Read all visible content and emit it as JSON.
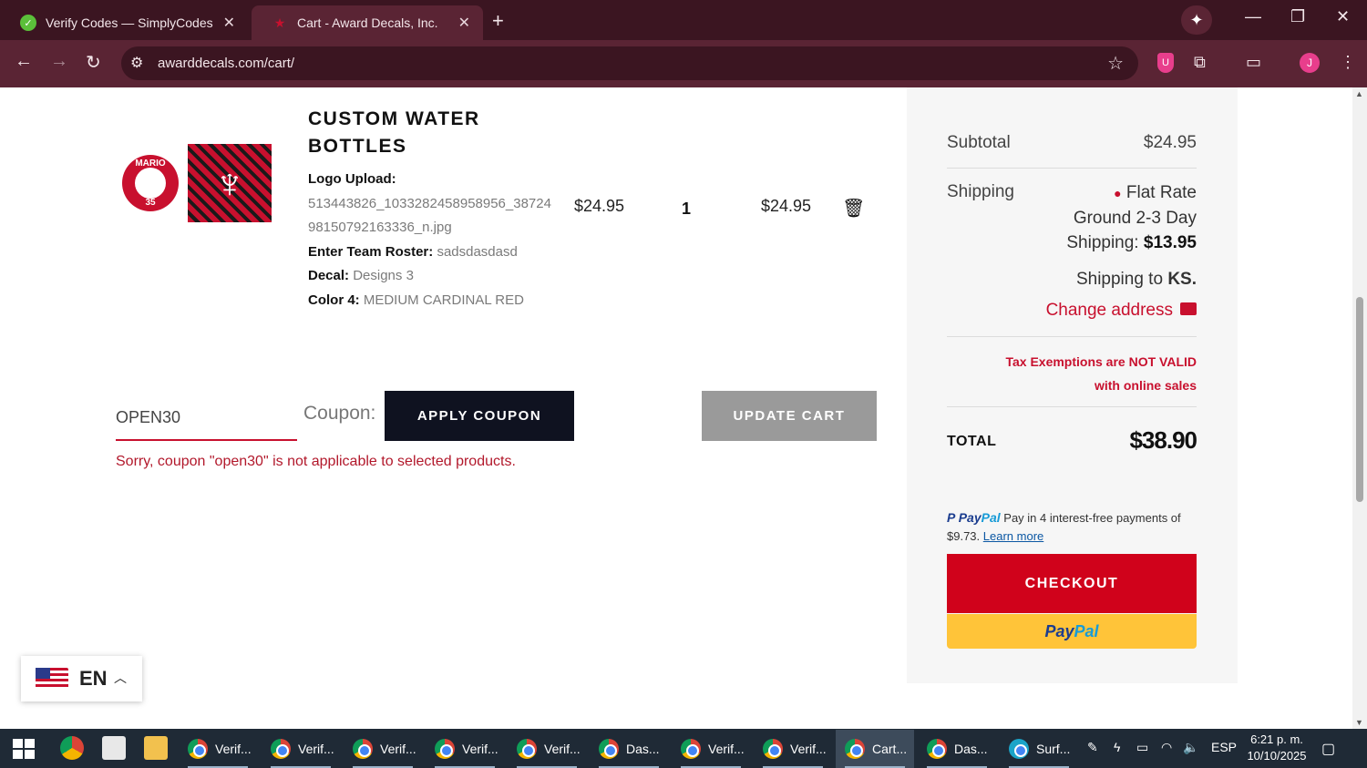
{
  "browser": {
    "tabs": [
      {
        "title": "Verify Codes — SimplyCodes",
        "active": false
      },
      {
        "title": "Cart - Award Decals, Inc.",
        "active": true
      }
    ],
    "url": "awarddecals.com/cart/"
  },
  "product": {
    "thumb_text_top": "MARIO",
    "thumb_text_bottom": "35",
    "name": "CUSTOM WATER BOTTLES",
    "logo_upload_label": "Logo Upload:",
    "logo_upload_value": "513443826_1033282458958956_3872498150792163336_n.jpg",
    "roster_label": "Enter Team Roster:",
    "roster_value": "sadsdasdasd",
    "decal_label": "Decal:",
    "decal_value": "Designs 3",
    "color_label": "Color 4:",
    "color_value": "MEDIUM CARDINAL RED",
    "price": "$24.95",
    "quantity": "1",
    "subtotal": "$24.95"
  },
  "coupon": {
    "input_value": "OPEN30",
    "label": "Coupon:",
    "apply_label": "APPLY COUPON",
    "update_label": "UPDATE CART",
    "error": "Sorry, coupon \"open30\" is not applicable to selected products."
  },
  "language": {
    "code": "EN"
  },
  "totals": {
    "subtotal_label": "Subtotal",
    "subtotal_value": "$24.95",
    "shipping_label": "Shipping",
    "shipping_method": "Flat Rate Ground 2-3 Day Shipping:",
    "shipping_cost": "$13.95",
    "shipping_to_prefix": "Shipping to",
    "shipping_to_state": "KS.",
    "change_address": "Change address",
    "tax_note_1": "Tax Exemptions are NOT VALID",
    "tax_note_2": "with online sales",
    "total_label": "TOTAL",
    "total_value": "$38.90",
    "paypal_message": "Pay in 4 interest-free payments of $9.73.",
    "paypal_learn_more": "Learn more",
    "checkout_label": "CHECKOUT"
  },
  "taskbar": {
    "tasks": [
      {
        "label": "Verif...",
        "active": false
      },
      {
        "label": "Verif...",
        "active": false
      },
      {
        "label": "Verif...",
        "active": false
      },
      {
        "label": "Verif...",
        "active": false
      },
      {
        "label": "Verif...",
        "active": false
      },
      {
        "label": "Das...",
        "active": false
      },
      {
        "label": "Verif...",
        "active": false
      },
      {
        "label": "Verif...",
        "active": false
      },
      {
        "label": "Cart...",
        "active": true
      },
      {
        "label": "Das...",
        "active": false
      },
      {
        "label": "Surf...",
        "active": false
      }
    ],
    "language": "ESP",
    "time": "6:21 p. m.",
    "date": "10/10/2025"
  },
  "colors": {
    "brand_red": "#c8102e",
    "checkout_red": "#d0021b",
    "paypal_yellow": "#ffc439",
    "chrome_frame": "#3b1521"
  }
}
